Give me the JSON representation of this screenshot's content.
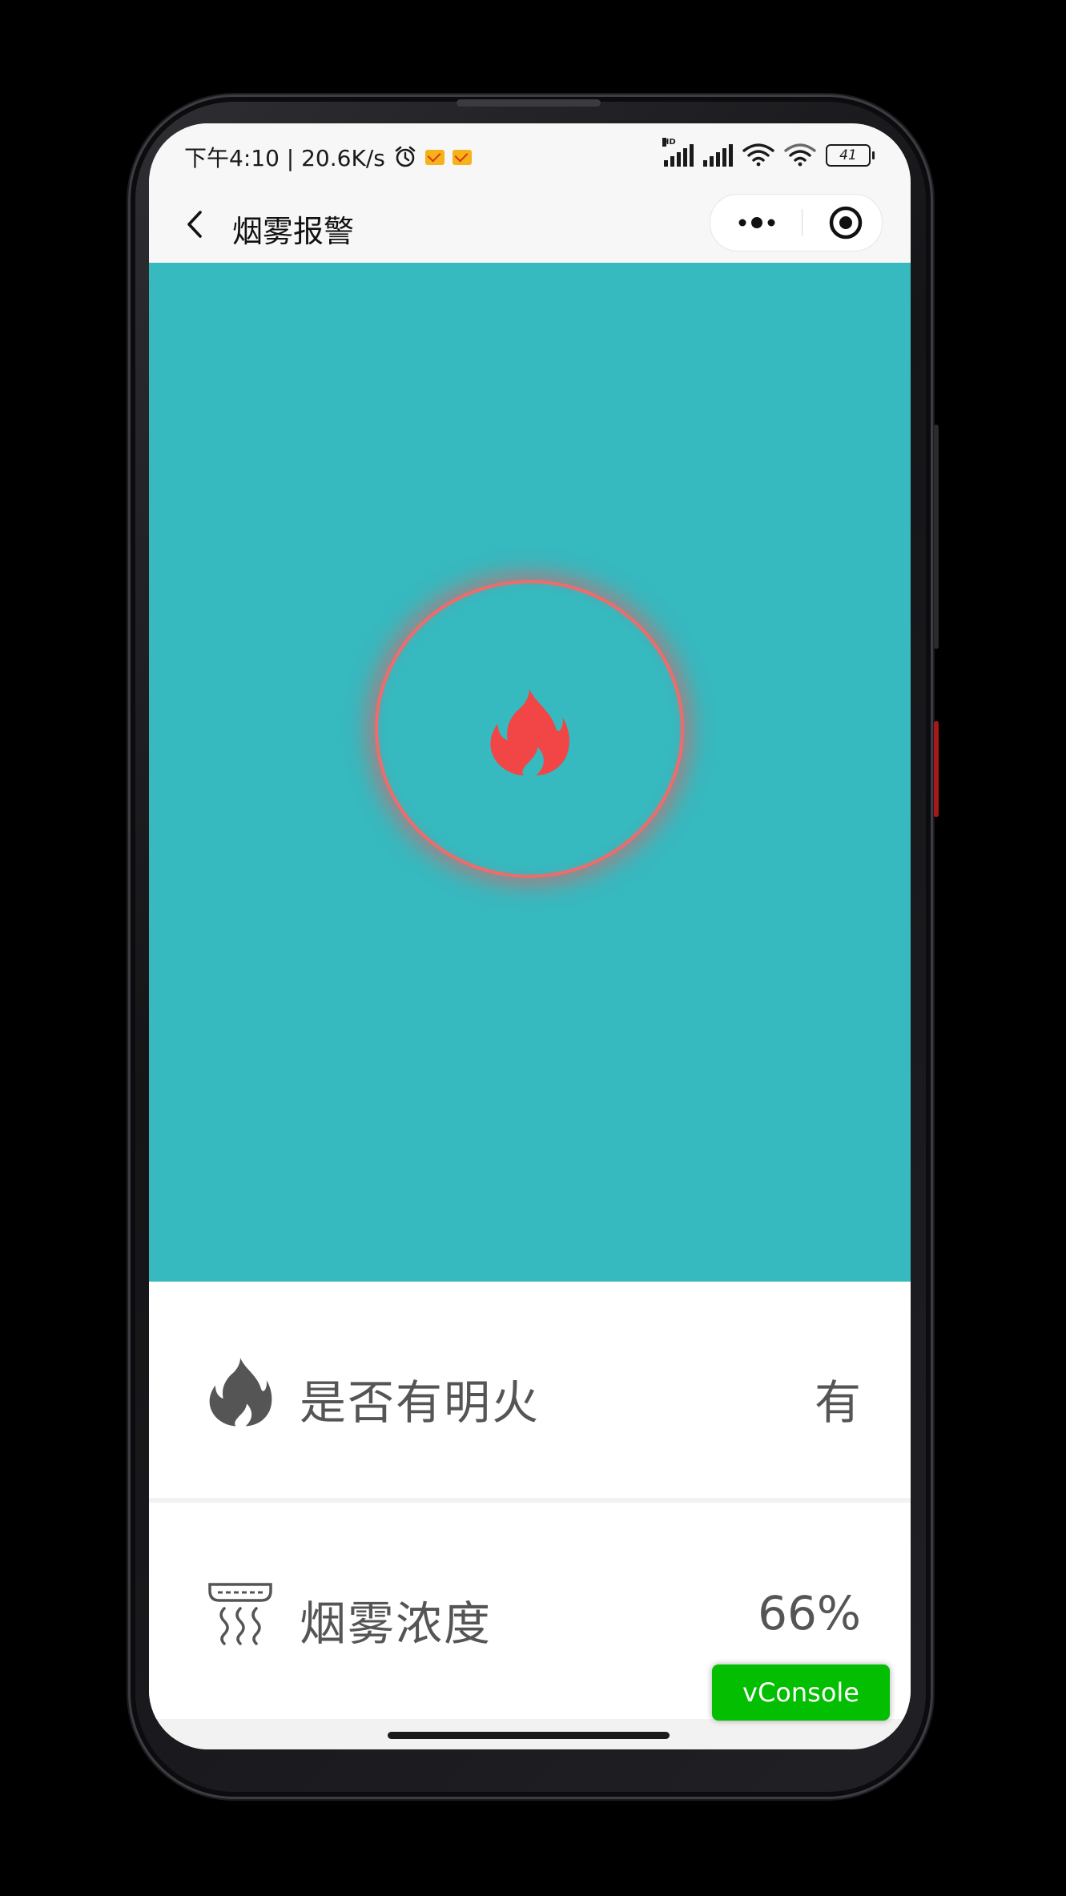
{
  "status_bar": {
    "time_and_speed": "下午4:10 | 20.6K/s",
    "hd_label": "HD",
    "battery": "41"
  },
  "nav": {
    "title": "烟雾报警"
  },
  "hero": {
    "alarm_color": "#f26a6a",
    "background": "#36b9bf",
    "icon": "flame-icon"
  },
  "sensors": [
    {
      "label": "是否有明火",
      "value": "有",
      "icon": "flame-icon"
    },
    {
      "label": "烟雾浓度",
      "value": "66%",
      "icon": "smoke-detector-icon"
    }
  ],
  "vconsole": {
    "label": "vConsole"
  }
}
